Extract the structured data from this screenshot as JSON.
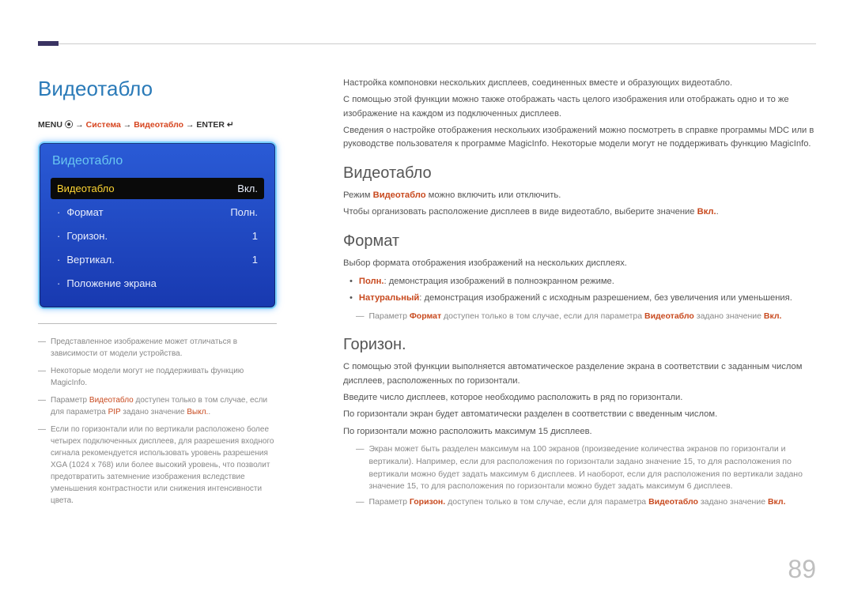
{
  "page_title": "Видеотабло",
  "page_number": "89",
  "breadcrumb": {
    "pre": "MENU ⦿ → ",
    "accent1": "Система",
    "mid1": " → ",
    "accent2": "Видеотабло",
    "mid2": " → ENTER ↵"
  },
  "osd": {
    "title": "Видеотабло",
    "rows": [
      {
        "label": "Видеотабло",
        "value": "Вкл.",
        "selected": true,
        "sub": false
      },
      {
        "label": "Формат",
        "value": "Полн.",
        "selected": false,
        "sub": true
      },
      {
        "label": "Горизон.",
        "value": "1",
        "selected": false,
        "sub": true
      },
      {
        "label": "Вертикал.",
        "value": "1",
        "selected": false,
        "sub": true
      },
      {
        "label": "Положение экрана",
        "value": "",
        "selected": false,
        "sub": true
      }
    ]
  },
  "left_notes": [
    {
      "text": "Представленное изображение может отличаться в зависимости от модели устройства."
    },
    {
      "text": "Некоторые модели могут не поддерживать функцию MagicInfo."
    },
    {
      "pre": "Параметр ",
      "k1": "Видеотабло",
      "mid": " доступен только в том случае, если для параметра ",
      "k2": "PIP",
      "post": " задано значение ",
      "k3": "Выкл.",
      "tail": "."
    },
    {
      "text": "Если по горизонтали или по вертикали расположено более четырех подключенных дисплеев, для разрешения входного сигнала рекомендуется использовать уровень разрешения XGA (1024 x 768) или более высокий уровень, что позволит предотвратить затемнение изображения вследствие уменьшения контрастности или снижения интенсивности цвета."
    }
  ],
  "intro_paragraphs": [
    "Настройка компоновки нескольких дисплеев, соединенных вместе и образующих видеотабло.",
    "С помощью этой функции можно также отображать часть целого изображения или отображать одно и то же изображение на каждом из подключенных дисплеев.",
    "Сведения о настройке отображения нескольких изображений можно посмотреть в справке программы MDC или в руководстве пользователя к программе MagicInfo. Некоторые модели могут не поддерживать функцию MagicInfo."
  ],
  "section_videotablo": {
    "title": "Видеотабло",
    "p1_pre": "Режим ",
    "p1_key": "Видеотабло",
    "p1_post": " можно включить или отключить.",
    "p2_pre": "Чтобы организовать расположение дисплеев в виде видеотабло, выберите значение ",
    "p2_key": "Вкл.",
    "p2_post": "."
  },
  "section_format": {
    "title": "Формат",
    "p1": "Выбор формата отображения изображений на нескольких дисплеях.",
    "bullets": [
      {
        "key": "Полн.",
        "text": ": демонстрация изображений в полноэкранном режиме."
      },
      {
        "key": "Натуральный",
        "text": ": демонстрация изображений с исходным разрешением, без увеличения или уменьшения."
      }
    ],
    "note": {
      "pre": "Параметр ",
      "k1": "Формат",
      "mid": " доступен только в том случае, если для параметра ",
      "k2": "Видеотабло",
      "post": " задано значение ",
      "k3": "Вкл."
    }
  },
  "section_horizon": {
    "title": "Горизон.",
    "p1": "С помощью этой функции выполняется автоматическое разделение экрана в соответствии с заданным числом дисплеев, расположенных по горизонтали.",
    "p2": "Введите число дисплеев, которое необходимо расположить в ряд по горизонтали.",
    "p3": "По горизонтали экран будет автоматически разделен в соответствии с введенным числом.",
    "p4": "По горизонтали можно расположить максимум 15 дисплеев.",
    "notes": [
      "Экран может быть разделен максимум на 100 экранов (произведение количества экранов по горизонтали и вертикали). Например, если для расположения по горизонтали задано значение 15, то для расположения по вертикали можно будет задать максимум 6 дисплеев. И наоборот, если для расположения по вертикали задано значение 15, то для расположения по горизонтали можно будет задать максимум 6 дисплеев."
    ],
    "note2": {
      "pre": "Параметр ",
      "k1": "Горизон.",
      "mid": " доступен только в том случае, если для параметра ",
      "k2": "Видеотабло",
      "post": " задано значение ",
      "k3": "Вкл."
    }
  }
}
